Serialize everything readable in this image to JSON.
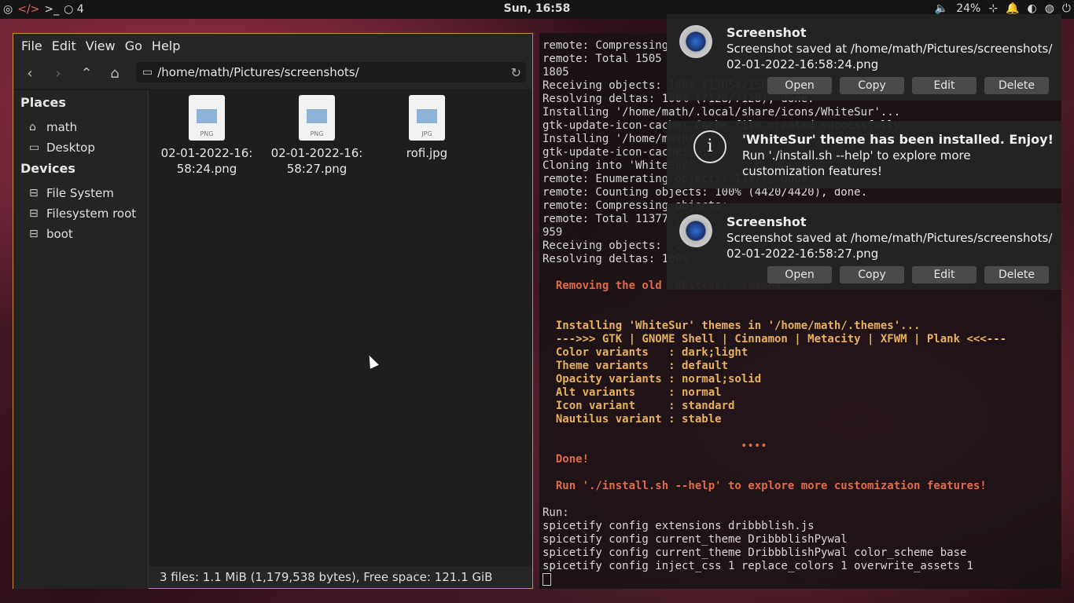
{
  "topbar": {
    "left_items": [
      "◎",
      "</>",
      ">_",
      "○ 4"
    ],
    "clock": "Sun, 16:58",
    "volume": "24%",
    "icons": [
      "volume-icon",
      "network-icon",
      "bell-icon",
      "toggle-icon",
      "palette-icon",
      "power-icon"
    ]
  },
  "filemanager": {
    "menu": [
      "File",
      "Edit",
      "View",
      "Go",
      "Help"
    ],
    "path": "/home/math/Pictures/screenshots/",
    "places_header": "Places",
    "places": [
      "math",
      "Desktop"
    ],
    "devices_header": "Devices",
    "devices": [
      "File System",
      "Filesystem root",
      "boot"
    ],
    "files": [
      {
        "name": "02-01-2022-16:\n58:24.png",
        "ext": "PNG"
      },
      {
        "name": "02-01-2022-16:\n58:27.png",
        "ext": "PNG"
      },
      {
        "name": "rofi.jpg",
        "ext": "JPG"
      }
    ],
    "status": "3 files: 1.1 MiB (1,179,538 bytes), Free space: 121.1 GiB"
  },
  "terminal": {
    "lines": [
      "remote: Compressing",
      "remote: Total 1505",
      "1805",
      "Receiving objects: 100% (15054/15054), 18.15 MiB | ...",
      "Resolving deltas: 100% (7128/7128), done.",
      "Installing '/home/math/.local/share/icons/WhiteSur'...",
      "gtk-update-icon-cache: Cache file created successfully.",
      "Installing '/home/math/...",
      "gtk-update-icon-cache: ...",
      "Cloning into 'WhiteSur'...",
      "remote: Enumerating objects: 11377, done.",
      "remote: Counting objects: 100% (4420/4420), done.",
      "remote: Compressing objects: ...",
      "remote: Total 11377 ...",
      "959",
      "Receiving objects: ...",
      "Resolving deltas: 100% ..."
    ],
    "removing": "  Removing the old 'WhiteSur' themes...",
    "installing": [
      "  Installing 'WhiteSur' themes in '/home/math/.themes'...",
      "  --->>> GTK | GNOME Shell | Cinnamon | Metacity | XFWM | Plank <<<---",
      "  Color variants   : dark;light",
      "  Theme variants   : default",
      "  Opacity variants : normal;solid",
      "  Alt variants     : normal",
      "  Icon variant     : standard",
      "  Nautilus variant : stable"
    ],
    "dots": "••••",
    "done": "  Done!",
    "run_hint": "  Run './install.sh --help' to explore more customization features!",
    "footer": [
      "Run:",
      "spicetify config extensions dribbblish.js",
      "spicetify config current_theme DribbblishPywal",
      "spicetify config current_theme DribbblishPywal color_scheme base",
      "spicetify config inject_css 1 replace_colors 1 overwrite_assets 1"
    ]
  },
  "notifications": [
    {
      "title": "Screenshot",
      "body": "Screenshot saved at /home/math/Pictures/screenshots/\n02-01-2022-16:58:24.png",
      "buttons": [
        "Open",
        "Copy",
        "Edit",
        "Delete"
      ]
    },
    {
      "title": "'WhiteSur' theme has been installed. Enjoy!",
      "body": "Run './install.sh --help' to explore more customization features!"
    },
    {
      "title": "Screenshot",
      "body": "Screenshot saved at /home/math/Pictures/screenshots/\n02-01-2022-16:58:27.png",
      "buttons": [
        "Open",
        "Copy",
        "Edit",
        "Delete"
      ]
    }
  ]
}
